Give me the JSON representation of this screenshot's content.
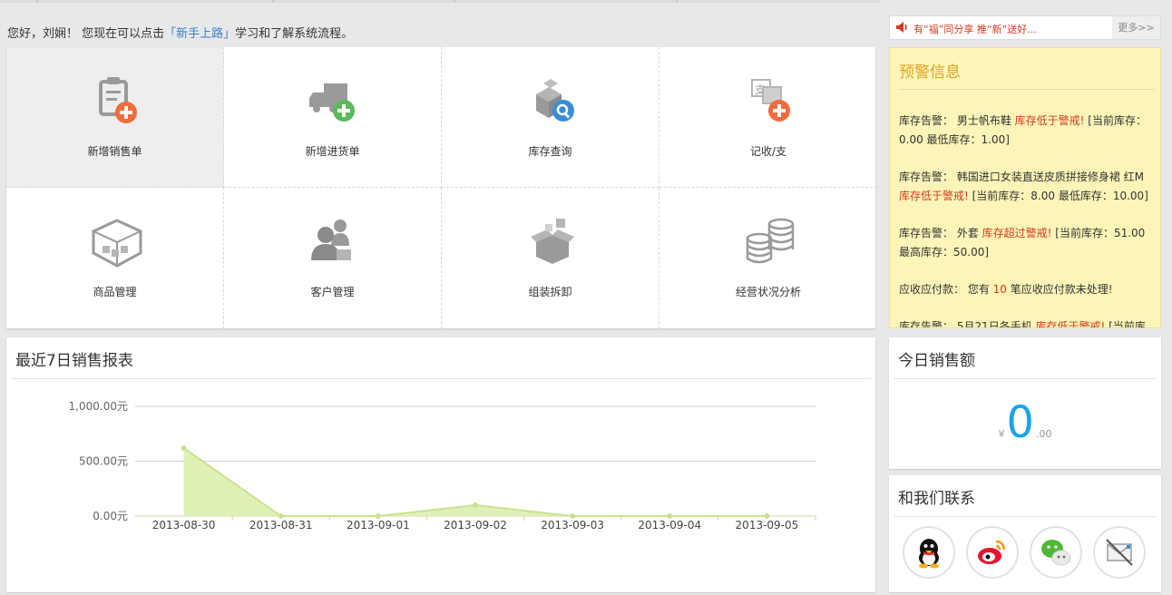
{
  "welcome": {
    "prefix": "您好，刘娴！ 您现在可以点击",
    "link": "「新手上路」",
    "suffix": "学习和了解系统流程。"
  },
  "tiles": [
    {
      "label": "新增销售单",
      "icon": "sales-order-add-icon"
    },
    {
      "label": "新增进货单",
      "icon": "purchase-order-add-icon"
    },
    {
      "label": "库存查询",
      "icon": "inventory-search-icon"
    },
    {
      "label": "记收/支",
      "icon": "income-expense-add-icon"
    },
    {
      "label": "商品管理",
      "icon": "goods-box-icon"
    },
    {
      "label": "客户管理",
      "icon": "customers-icon"
    },
    {
      "label": "组装拆卸",
      "icon": "assembly-box-icon"
    },
    {
      "label": "经营状况分析",
      "icon": "coins-stack-icon"
    }
  ],
  "notice": {
    "text": "有“福”同分享 推“新”送好...",
    "more": "更多>>"
  },
  "warnings": {
    "title": "预警信息",
    "items": [
      {
        "prefix": "库存告警：  男士帆布鞋 ",
        "alert": "库存低于警戒!",
        "suffix": " [当前库存：0.00 最低库存：1.00]"
      },
      {
        "prefix": "库存告警：  韩国进口女装直送皮质拼接修身裙 红M ",
        "alert": "库存低于警戒!",
        "suffix": " [当前库存：8.00 最低库存：10.00]"
      },
      {
        "prefix": "库存告警：  外套 ",
        "alert": "库存超过警戒!",
        "suffix": " [当前库存：51.00 最高库存：50.00]"
      },
      {
        "prefix": "应收应付款：  您有 ",
        "alert": "10",
        "suffix": " 笔应收应付款未处理!"
      },
      {
        "prefix": "库存告警：  5月21日各手机 ",
        "alert": "库存低于警戒!",
        "suffix": " [当前库"
      }
    ]
  },
  "report": {
    "title": "最近7日销售报表"
  },
  "chart_data": {
    "type": "area",
    "categories": [
      "2013-08-30",
      "2013-08-31",
      "2013-09-01",
      "2013-09-02",
      "2013-09-03",
      "2013-09-04",
      "2013-09-05"
    ],
    "values": [
      620,
      0,
      0,
      100,
      0,
      0,
      0
    ],
    "ytick_labels": [
      "1,000.00元",
      "500.00元",
      "0.00元"
    ],
    "yticks": [
      1000,
      500,
      0
    ],
    "ylim": [
      0,
      1000
    ],
    "grid": true,
    "color": "#dff0b6",
    "line_color": "#c9e28f"
  },
  "today": {
    "title": "今日销售额",
    "currency": "¥",
    "value": "0",
    "decimals": ".00"
  },
  "contact": {
    "title": "和我们联系",
    "icons": [
      "qq-icon",
      "weibo-icon",
      "wechat-icon",
      "email-icon"
    ]
  },
  "colors": {
    "accent_orange": "#f06b3d",
    "accent_green": "#5cb85c",
    "accent_blue": "#3a8fd4",
    "value_blue": "#1aa3e6",
    "warning_title": "#e0a428",
    "alert_red": "#d9391f"
  }
}
